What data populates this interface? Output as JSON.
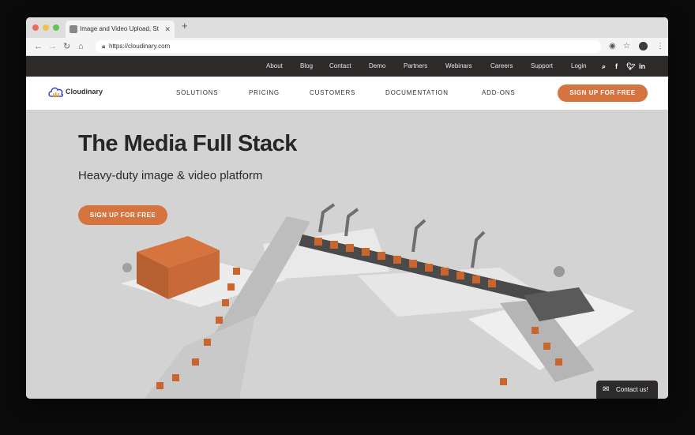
{
  "browser": {
    "tab_title": "Image and Video Upload, Stor...",
    "new_tab": "+",
    "url": "https://cloudinary.com",
    "icons": [
      "back-icon",
      "forward-icon",
      "reload-icon",
      "home-icon",
      "lock-icon",
      "extension-icon",
      "star-icon",
      "profile-icon",
      "menu-icon"
    ]
  },
  "utility_nav": {
    "links": [
      "About",
      "Blog",
      "Contact",
      "Demo",
      "Partners",
      "Webinars",
      "Careers",
      "Support",
      "Login"
    ],
    "icons": [
      "search-icon",
      "facebook-icon",
      "twitter-icon",
      "linkedin-icon"
    ]
  },
  "main_nav": {
    "logo_text": "Cloudinary",
    "links": [
      "SOLUTIONS",
      "PRICING",
      "CUSTOMERS",
      "DOCUMENTATION",
      "ADD-ONS"
    ],
    "cta": "SIGN UP FOR FREE"
  },
  "hero": {
    "title": "The Media Full Stack",
    "subtitle": "Heavy-duty image & video platform",
    "cta": "SIGN UP FOR FREE"
  },
  "contact_widget": {
    "label": "Contact us!",
    "icon": "envelope-icon"
  },
  "colors": {
    "accent": "#d5743f",
    "dark_bar": "#2d2a2a",
    "hero_bg": "#d3d3d3"
  }
}
